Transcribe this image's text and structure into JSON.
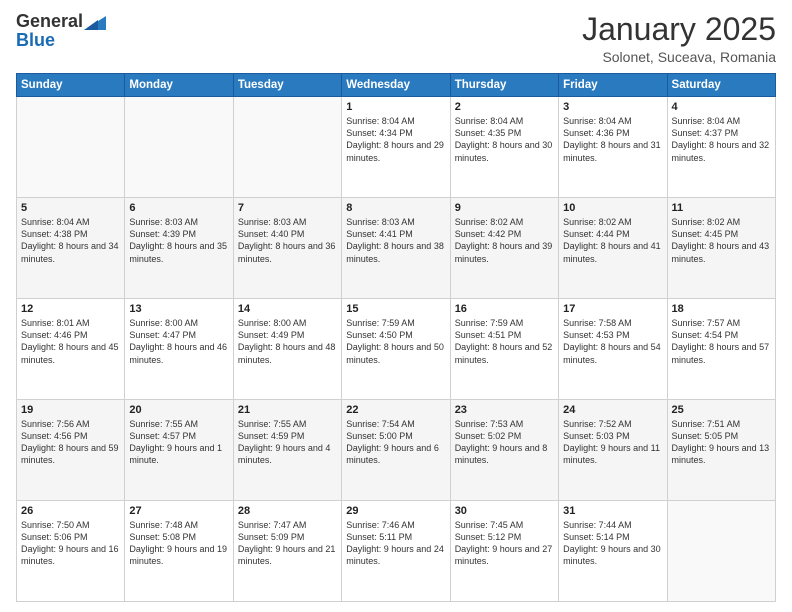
{
  "header": {
    "logo": {
      "general": "General",
      "blue": "Blue"
    },
    "title": "January 2025",
    "location": "Solonet, Suceava, Romania"
  },
  "days_of_week": [
    "Sunday",
    "Monday",
    "Tuesday",
    "Wednesday",
    "Thursday",
    "Friday",
    "Saturday"
  ],
  "weeks": [
    [
      {
        "day": "",
        "info": ""
      },
      {
        "day": "",
        "info": ""
      },
      {
        "day": "",
        "info": ""
      },
      {
        "day": "1",
        "info": "Sunrise: 8:04 AM\nSunset: 4:34 PM\nDaylight: 8 hours and 29 minutes."
      },
      {
        "day": "2",
        "info": "Sunrise: 8:04 AM\nSunset: 4:35 PM\nDaylight: 8 hours and 30 minutes."
      },
      {
        "day": "3",
        "info": "Sunrise: 8:04 AM\nSunset: 4:36 PM\nDaylight: 8 hours and 31 minutes."
      },
      {
        "day": "4",
        "info": "Sunrise: 8:04 AM\nSunset: 4:37 PM\nDaylight: 8 hours and 32 minutes."
      }
    ],
    [
      {
        "day": "5",
        "info": "Sunrise: 8:04 AM\nSunset: 4:38 PM\nDaylight: 8 hours and 34 minutes."
      },
      {
        "day": "6",
        "info": "Sunrise: 8:03 AM\nSunset: 4:39 PM\nDaylight: 8 hours and 35 minutes."
      },
      {
        "day": "7",
        "info": "Sunrise: 8:03 AM\nSunset: 4:40 PM\nDaylight: 8 hours and 36 minutes."
      },
      {
        "day": "8",
        "info": "Sunrise: 8:03 AM\nSunset: 4:41 PM\nDaylight: 8 hours and 38 minutes."
      },
      {
        "day": "9",
        "info": "Sunrise: 8:02 AM\nSunset: 4:42 PM\nDaylight: 8 hours and 39 minutes."
      },
      {
        "day": "10",
        "info": "Sunrise: 8:02 AM\nSunset: 4:44 PM\nDaylight: 8 hours and 41 minutes."
      },
      {
        "day": "11",
        "info": "Sunrise: 8:02 AM\nSunset: 4:45 PM\nDaylight: 8 hours and 43 minutes."
      }
    ],
    [
      {
        "day": "12",
        "info": "Sunrise: 8:01 AM\nSunset: 4:46 PM\nDaylight: 8 hours and 45 minutes."
      },
      {
        "day": "13",
        "info": "Sunrise: 8:00 AM\nSunset: 4:47 PM\nDaylight: 8 hours and 46 minutes."
      },
      {
        "day": "14",
        "info": "Sunrise: 8:00 AM\nSunset: 4:49 PM\nDaylight: 8 hours and 48 minutes."
      },
      {
        "day": "15",
        "info": "Sunrise: 7:59 AM\nSunset: 4:50 PM\nDaylight: 8 hours and 50 minutes."
      },
      {
        "day": "16",
        "info": "Sunrise: 7:59 AM\nSunset: 4:51 PM\nDaylight: 8 hours and 52 minutes."
      },
      {
        "day": "17",
        "info": "Sunrise: 7:58 AM\nSunset: 4:53 PM\nDaylight: 8 hours and 54 minutes."
      },
      {
        "day": "18",
        "info": "Sunrise: 7:57 AM\nSunset: 4:54 PM\nDaylight: 8 hours and 57 minutes."
      }
    ],
    [
      {
        "day": "19",
        "info": "Sunrise: 7:56 AM\nSunset: 4:56 PM\nDaylight: 8 hours and 59 minutes."
      },
      {
        "day": "20",
        "info": "Sunrise: 7:55 AM\nSunset: 4:57 PM\nDaylight: 9 hours and 1 minute."
      },
      {
        "day": "21",
        "info": "Sunrise: 7:55 AM\nSunset: 4:59 PM\nDaylight: 9 hours and 4 minutes."
      },
      {
        "day": "22",
        "info": "Sunrise: 7:54 AM\nSunset: 5:00 PM\nDaylight: 9 hours and 6 minutes."
      },
      {
        "day": "23",
        "info": "Sunrise: 7:53 AM\nSunset: 5:02 PM\nDaylight: 9 hours and 8 minutes."
      },
      {
        "day": "24",
        "info": "Sunrise: 7:52 AM\nSunset: 5:03 PM\nDaylight: 9 hours and 11 minutes."
      },
      {
        "day": "25",
        "info": "Sunrise: 7:51 AM\nSunset: 5:05 PM\nDaylight: 9 hours and 13 minutes."
      }
    ],
    [
      {
        "day": "26",
        "info": "Sunrise: 7:50 AM\nSunset: 5:06 PM\nDaylight: 9 hours and 16 minutes."
      },
      {
        "day": "27",
        "info": "Sunrise: 7:48 AM\nSunset: 5:08 PM\nDaylight: 9 hours and 19 minutes."
      },
      {
        "day": "28",
        "info": "Sunrise: 7:47 AM\nSunset: 5:09 PM\nDaylight: 9 hours and 21 minutes."
      },
      {
        "day": "29",
        "info": "Sunrise: 7:46 AM\nSunset: 5:11 PM\nDaylight: 9 hours and 24 minutes."
      },
      {
        "day": "30",
        "info": "Sunrise: 7:45 AM\nSunset: 5:12 PM\nDaylight: 9 hours and 27 minutes."
      },
      {
        "day": "31",
        "info": "Sunrise: 7:44 AM\nSunset: 5:14 PM\nDaylight: 9 hours and 30 minutes."
      },
      {
        "day": "",
        "info": ""
      }
    ]
  ]
}
